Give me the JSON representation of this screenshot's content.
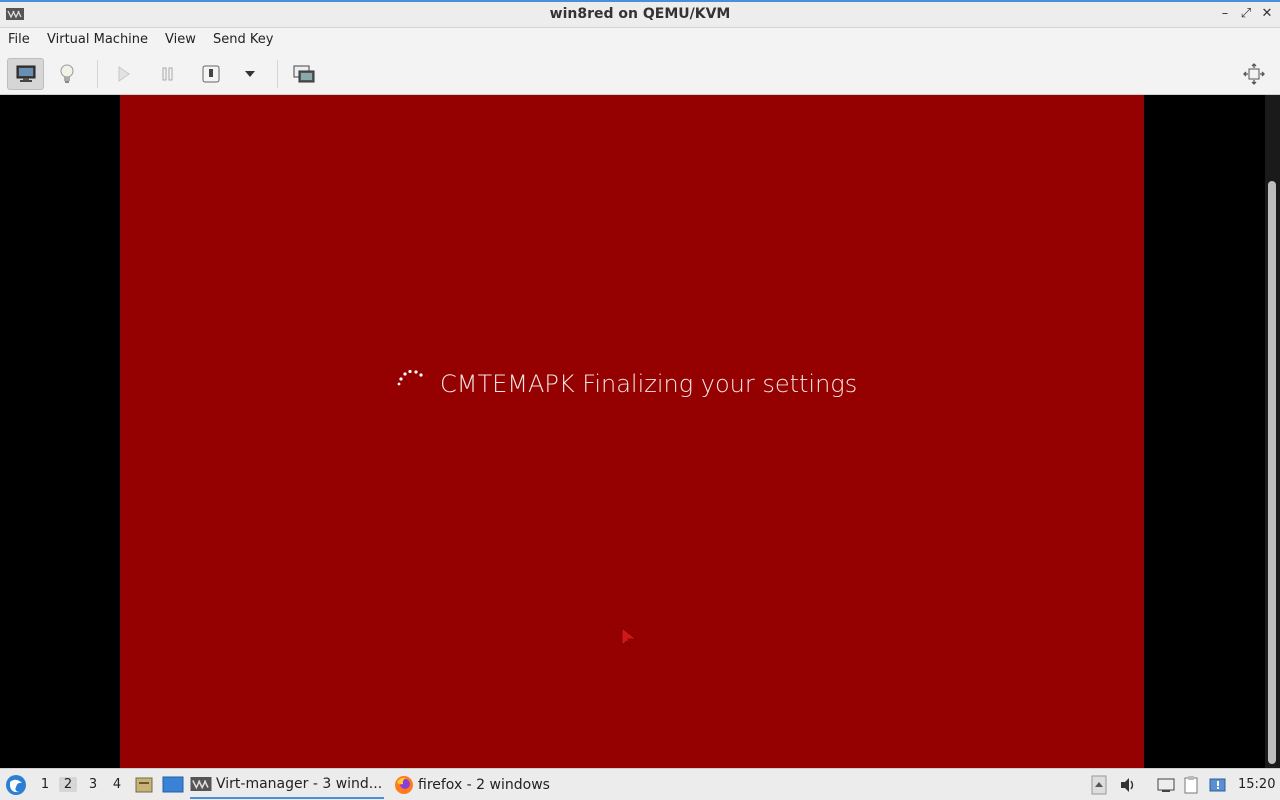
{
  "window": {
    "title": "win8red on QEMU/KVM",
    "minimize_icon": "minimize-icon",
    "maximize_icon": "maximize-icon",
    "close_icon": "close-icon"
  },
  "menu": {
    "items": [
      "File",
      "Virtual Machine",
      "View",
      "Send Key"
    ]
  },
  "toolbar": {
    "buttons": [
      "console-icon",
      "details-lightbulb-icon",
      "run-icon",
      "pause-icon",
      "shutdown-icon",
      "shutdown-menu-chevron-icon",
      "snapshots-icon",
      "fullscreen-icon"
    ]
  },
  "vm": {
    "background": "#950000",
    "message": "CMTEMAPK Finalizing your settings"
  },
  "taskbar": {
    "workspaces": [
      "1",
      "2",
      "3",
      "4"
    ],
    "current_workspace": "2",
    "tasks": [
      {
        "label": "Virt-manager - 3 wind...",
        "icon": "virt-manager-icon",
        "active": true
      },
      {
        "label": "firefox - 2 windows",
        "icon": "firefox-icon",
        "active": false
      }
    ],
    "clock": "15:20"
  }
}
